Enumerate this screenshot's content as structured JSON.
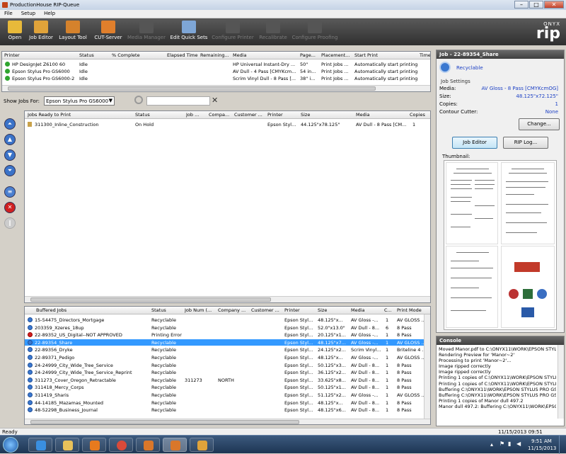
{
  "window": {
    "title": "ProductionHouse RIP-Queue"
  },
  "menu": [
    "File",
    "Setup",
    "Help"
  ],
  "toolbar": {
    "items": [
      {
        "label": "Open",
        "enabled": true,
        "icon": "folder-icon"
      },
      {
        "label": "Job Editor",
        "enabled": true,
        "icon": "job-editor-icon"
      },
      {
        "label": "Layout Tool",
        "enabled": true,
        "icon": "layout-tool-icon"
      },
      {
        "label": "CUT-Server",
        "enabled": true,
        "icon": "cut-server-icon"
      },
      {
        "label": "Media Manager",
        "enabled": false,
        "icon": "media-manager-icon"
      },
      {
        "label": "Edit Quick Sets",
        "enabled": true,
        "icon": "quick-sets-icon"
      },
      {
        "label": "Configure Printer",
        "enabled": false,
        "icon": "printer-icon"
      },
      {
        "label": "Recalibrate",
        "enabled": false,
        "icon": "recalibrate-icon"
      },
      {
        "label": "Configure Proofing",
        "enabled": false,
        "icon": "proofing-icon"
      }
    ],
    "logo_small": "ONYX",
    "logo_big": "rip"
  },
  "printers": {
    "headers": [
      "Printer",
      "Status",
      "% Complete",
      "Elapsed Time",
      "Remaining...",
      "Media",
      "Page...",
      "Placement...",
      "Start Print",
      "Time"
    ],
    "rows": [
      {
        "printer": "HP DesignJet Z6100 60",
        "status": "Idle",
        "media": "HP Universal Instant-Dry ...",
        "page": "50\"",
        "placement": "Print Jobs ...",
        "start": "Automatically start printing"
      },
      {
        "printer": "Epson Stylus Pro GS6000",
        "status": "Idle",
        "media": "AV Dull - 4 Pass [CMYKcm...",
        "page": "54 in...",
        "placement": "Print Jobs ...",
        "start": "Automatically start printing"
      },
      {
        "printer": "Epson Stylus Pro GS6000-2",
        "status": "Idle",
        "media": "Scrim Vinyl Dull - 8 Pass [...",
        "page": "38\" i...",
        "placement": "Print Jobs ...",
        "start": "Automatically start printing"
      }
    ]
  },
  "filter": {
    "label": "Show Jobs For:",
    "selected": "Epson Stylus Pro GS6000"
  },
  "ready_jobs": {
    "headers": [
      "Jobs Ready to Print",
      "Status",
      "Job ...",
      "Compa...",
      "Customer ...",
      "Printer",
      "Size",
      "Media",
      "Copies"
    ],
    "rows": [
      {
        "name": "311300_Inline_Construction",
        "status": "On Hold",
        "printer": "Epson Styl...",
        "size": "44.125\"x78.125\"",
        "media": "AV Dull - 8 Pass [CM...",
        "copies": "1"
      }
    ]
  },
  "buffered_jobs": {
    "headers": [
      "Buffered Jobs",
      "Status",
      "Job Num (...",
      "Company ...",
      "Customer ...",
      "Printer",
      "Size",
      "Media",
      "C...",
      "Print Mode"
    ],
    "rows": [
      {
        "name": "15-54475_Directors_Mortgage",
        "status": "Recyclable",
        "jobnum": "",
        "company": "",
        "printer": "Epson Styl...",
        "size": "48.125\"x...",
        "media": "AV Gloss -...",
        "c": "1",
        "mode": "AV GLOSS ...",
        "state": "blue"
      },
      {
        "name": "203359_Xzeres_18up",
        "status": "Recyclable",
        "jobnum": "",
        "company": "",
        "printer": "Epson Styl...",
        "size": "52.0\"x13.0\"",
        "media": "AV Dull - 8...",
        "c": "6",
        "mode": "8 Pass",
        "state": "blue"
      },
      {
        "name": "22-89352_US_Digital--NOT APPROVED",
        "status": "Printing Error",
        "jobnum": "",
        "company": "",
        "printer": "Epson Styl...",
        "size": "20.125\"x1...",
        "media": "AV Gloss -...",
        "c": "1",
        "mode": "8 Pass",
        "state": "red"
      },
      {
        "name": "22-89354_Share",
        "status": "Recyclable",
        "jobnum": "",
        "company": "",
        "printer": "Epson Styl...",
        "size": "48.125\"x7...",
        "media": "AV Gloss -...",
        "c": "1",
        "mode": "AV GLOSS ...",
        "state": "blue"
      },
      {
        "name": "22-89356_Dryke",
        "status": "Recyclable",
        "jobnum": "",
        "company": "",
        "printer": "Epson Styl...",
        "size": "24.125\"x2...",
        "media": "Scrim Vinyl...",
        "c": "1",
        "mode": "Briteline 4 ...",
        "state": "blue"
      },
      {
        "name": "22-89371_Pedigo",
        "status": "Recyclable",
        "jobnum": "",
        "company": "",
        "printer": "Epson Styl...",
        "size": "48.125\"x...",
        "media": "AV Gloss -...",
        "c": "1",
        "mode": "AV GLOSS ...",
        "state": "blue"
      },
      {
        "name": "24-24999_City_Wide_Tree_Service",
        "status": "Recyclable",
        "jobnum": "",
        "company": "",
        "printer": "Epson Styl...",
        "size": "50.125\"x3...",
        "media": "AV Dull - 8...",
        "c": "1",
        "mode": "8 Pass",
        "state": "blue"
      },
      {
        "name": "24-24999_City_Wide_Tree_Service_Reprint",
        "status": "Recyclable",
        "jobnum": "",
        "company": "",
        "printer": "Epson Styl...",
        "size": "36.125\"x2...",
        "media": "AV Dull - 8...",
        "c": "1",
        "mode": "8 Pass",
        "state": "blue"
      },
      {
        "name": "311273_Cover_Oregon_Retractable",
        "status": "Recyclable",
        "jobnum": "311273",
        "company": "NORTH",
        "printer": "Epson Styl...",
        "size": "33.625\"x8...",
        "media": "AV Dull - 8...",
        "c": "1",
        "mode": "8 Pass",
        "state": "blue"
      },
      {
        "name": "311418_Mercy_Corps",
        "status": "Recyclable",
        "jobnum": "",
        "company": "",
        "printer": "Epson Styl...",
        "size": "50.125\"x1...",
        "media": "AV Dull - 8...",
        "c": "1",
        "mode": "8 Pass",
        "state": "blue"
      },
      {
        "name": "311419_Sharis",
        "status": "Recyclable",
        "jobnum": "",
        "company": "",
        "printer": "Epson Styl...",
        "size": "51.125\"x2...",
        "media": "AV Gloss -...",
        "c": "1",
        "mode": "AV GLOSS ...",
        "state": "blue"
      },
      {
        "name": "44-14185_Mazamas_Mounted",
        "status": "Recyclable",
        "jobnum": "",
        "company": "",
        "printer": "Epson Styl...",
        "size": "48.125\"x...",
        "media": "AV Dull - 8...",
        "c": "1",
        "mode": "8 Pass",
        "state": "blue"
      },
      {
        "name": "48-52298_Business_Journal",
        "status": "Recyclable",
        "jobnum": "",
        "company": "",
        "printer": "Epson Styl...",
        "size": "48.125\"x6...",
        "media": "AV Dull - 8...",
        "c": "1",
        "mode": "8 Pass",
        "state": "blue"
      }
    ],
    "selected_index": 3
  },
  "job_panel": {
    "title": "Job - 22-89354_Share",
    "status": "Recyclable",
    "settings_label": "Job Settings",
    "fields": [
      {
        "label": "Media:",
        "value": "AV Gloss - 8 Pass [CMYKcmOG]"
      },
      {
        "label": "Size:",
        "value": "48.125\"x72.125\""
      },
      {
        "label": "Copies:",
        "value": "1"
      },
      {
        "label": "Contour Cutter:",
        "value": "None"
      }
    ],
    "change_button": "Change...",
    "job_editor_button": "Job Editor",
    "rip_log_button": "RIP Log...",
    "thumbnail_label": "Thumbnail:"
  },
  "console": {
    "title": "Console",
    "lines": [
      "Moved Manor.pdf to C:\\ONYX11\\WORK\\EPSON STYLU",
      "Rendering Preview for 'Manor~2'",
      "Processing to print 'Manor~2'...",
      "Image ripped correctly",
      "Image ripped correctly",
      "Printing 1 copies of C:\\ONYX11\\WORK\\EPSON STYLUS",
      "Printing 1 copies of C:\\ONYX11\\WORK\\EPSON STYLUS",
      "Buffering C:\\ONYX11\\WORK\\EPSON STYLUS PRO GSE",
      "Buffering C:\\ONYX11\\WORK\\EPSON STYLUS PRO GSE",
      "Printing 1 copies of Manor dull 497.2",
      "Manor dull 497.2: Buffering C:\\ONYX11\\WORK\\EPSON"
    ]
  },
  "status_bar": {
    "text": "Ready",
    "datetime": "11/15/2013  09:51"
  },
  "taskbar": {
    "time": "9:51 AM",
    "date": "11/15/2013"
  },
  "colors": {
    "toolbar": "#3d3d3d",
    "selection": "#3399ff",
    "link_blue": "#1b3fc4",
    "idle_green": "#2fa52f",
    "error_red": "#d02020"
  }
}
